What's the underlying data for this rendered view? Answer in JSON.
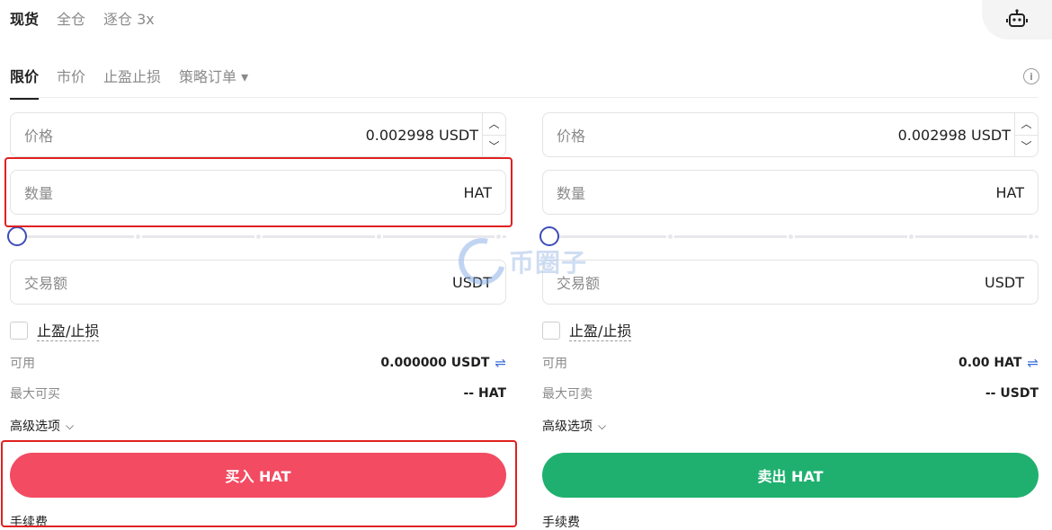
{
  "top_tabs": [
    "现货",
    "全仓",
    "逐仓 3x"
  ],
  "order_tabs": [
    "限价",
    "市价",
    "止盈止损",
    "策略订单 ▾"
  ],
  "info_icon": "info-icon",
  "robot_icon": "robot-icon",
  "buy": {
    "price_label": "价格",
    "price_value": "0.002998 USDT",
    "qty_label": "数量",
    "qty_unit": "HAT",
    "total_label": "交易额",
    "total_unit": "USDT",
    "tpsl_label": "止盈/止损",
    "available_label": "可用",
    "available_value": "0.000000 USDT",
    "max_label": "最大可买",
    "max_value": "-- HAT",
    "advanced_label": "高级选项",
    "button_label": "买入 HAT",
    "fee_label": "手续费"
  },
  "sell": {
    "price_label": "价格",
    "price_value": "0.002998 USDT",
    "qty_label": "数量",
    "qty_unit": "HAT",
    "total_label": "交易额",
    "total_unit": "USDT",
    "tpsl_label": "止盈/止损",
    "available_label": "可用",
    "available_value": "0.00 HAT",
    "max_label": "最大可卖",
    "max_value": "-- USDT",
    "advanced_label": "高级选项",
    "button_label": "卖出 HAT",
    "fee_label": "手续费"
  },
  "slider_percent": 0,
  "watermark_text": "币圈子",
  "colors": {
    "buy": "#f24b62",
    "sell": "#1fb06f",
    "accent": "#3d4db8",
    "highlight": "#e02020"
  }
}
